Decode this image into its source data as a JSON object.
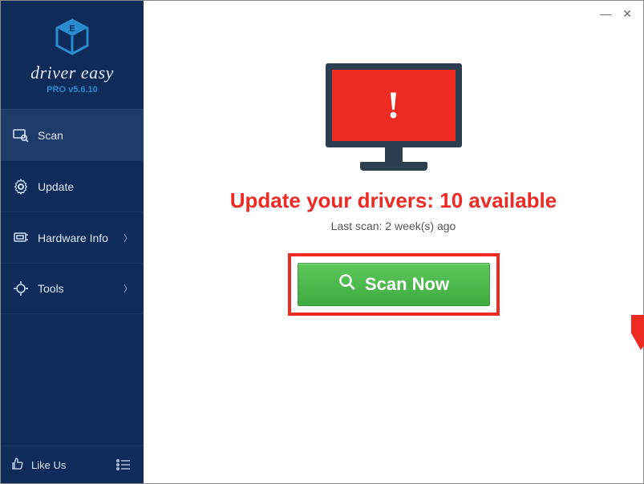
{
  "brand": {
    "name": "driver easy",
    "version_label": "PRO v5.6.10"
  },
  "sidebar": {
    "items": [
      {
        "label": "Scan",
        "icon": "scan-icon",
        "chevron": false,
        "active": true
      },
      {
        "label": "Update",
        "icon": "gear-icon",
        "chevron": false,
        "active": false
      },
      {
        "label": "Hardware Info",
        "icon": "hardware-icon",
        "chevron": true,
        "active": false
      },
      {
        "label": "Tools",
        "icon": "tools-icon",
        "chevron": true,
        "active": false
      }
    ],
    "footer": {
      "like_label": "Like Us"
    }
  },
  "main": {
    "headline": "Update your drivers: 10 available",
    "subline": "Last scan: 2 week(s) ago",
    "scan_button_label": "Scan Now"
  },
  "colors": {
    "alert": "#ee2a24",
    "accent_green": "#4abb4a",
    "sidebar_bg": "#0f2b59"
  }
}
